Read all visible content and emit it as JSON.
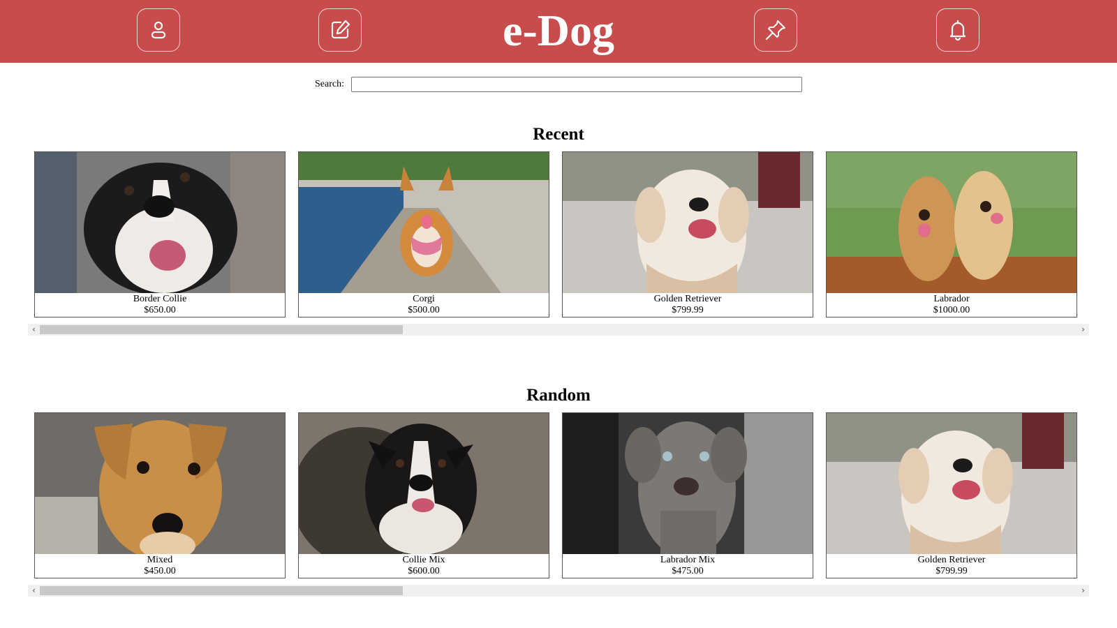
{
  "header": {
    "brand": "e-Dog",
    "background_color": "#c94c4c",
    "buttons": [
      {
        "name": "profile",
        "icon": "user-icon"
      },
      {
        "name": "edit",
        "icon": "edit-icon"
      },
      {
        "name": "pin",
        "icon": "pin-icon"
      },
      {
        "name": "notifications",
        "icon": "bell-icon"
      }
    ]
  },
  "search": {
    "label": "Search:",
    "value": "",
    "placeholder": ""
  },
  "sections": [
    {
      "title": "Recent",
      "cards": [
        {
          "name": "Border Collie",
          "price": "$650.00",
          "photo": "border-collie-photo"
        },
        {
          "name": "Corgi",
          "price": "$500.00",
          "photo": "corgi-photo"
        },
        {
          "name": "Golden Retriever",
          "price": "$799.99",
          "photo": "golden-retriever-photo"
        },
        {
          "name": "Labrador",
          "price": "$1000.00",
          "photo": "labrador-puppies-photo"
        }
      ],
      "scroll_position": 0
    },
    {
      "title": "Random",
      "cards": [
        {
          "name": "Mixed",
          "price": "$450.00",
          "photo": "mixed-dog-photo"
        },
        {
          "name": "Collie Mix",
          "price": "$600.00",
          "photo": "collie-mix-photo"
        },
        {
          "name": "Labrador Mix",
          "price": "$475.00",
          "photo": "labrador-mix-photo"
        },
        {
          "name": "Golden Retriever",
          "price": "$799.99",
          "photo": "golden-retriever-photo"
        }
      ],
      "scroll_position": 0
    }
  ]
}
